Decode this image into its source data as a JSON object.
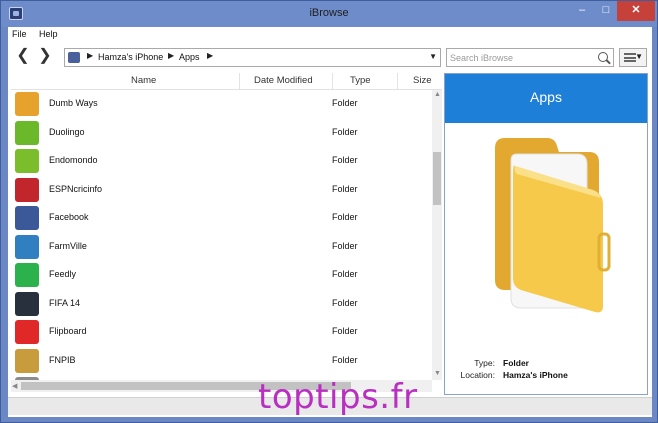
{
  "window": {
    "title": "iBrowse"
  },
  "menu": [
    "File",
    "Help"
  ],
  "address": {
    "crumbs": [
      "Hamza's iPhone",
      "Apps"
    ]
  },
  "search": {
    "placeholder": "Search iBrowse"
  },
  "columns": [
    "Name",
    "Date Modified",
    "Type",
    "Size"
  ],
  "rows": [
    {
      "name": "Dumb Ways",
      "type": "Folder",
      "icon": "dumb-ways-icon",
      "color": "#e6a22c"
    },
    {
      "name": "Duolingo",
      "type": "Folder",
      "icon": "duolingo-icon",
      "color": "#6bb82b"
    },
    {
      "name": "Endomondo",
      "type": "Folder",
      "icon": "endomondo-icon",
      "color": "#7bbd2a"
    },
    {
      "name": "ESPNcricinfo",
      "type": "Folder",
      "icon": "espncricinfo-icon",
      "color": "#c0262b"
    },
    {
      "name": "Facebook",
      "type": "Folder",
      "icon": "facebook-icon",
      "color": "#3b5998"
    },
    {
      "name": "FarmVille",
      "type": "Folder",
      "icon": "farmville-icon",
      "color": "#2f7fc1"
    },
    {
      "name": "Feedly",
      "type": "Folder",
      "icon": "feedly-icon",
      "color": "#2bb24c"
    },
    {
      "name": "FIFA 14",
      "type": "Folder",
      "icon": "fifa-14-icon",
      "color": "#28303d"
    },
    {
      "name": "Flipboard",
      "type": "Folder",
      "icon": "flipboard-icon",
      "color": "#e12828"
    },
    {
      "name": "FNPIB",
      "type": "Folder",
      "icon": "fnpib-icon",
      "color": "#c89b3c"
    },
    {
      "name": "",
      "type": "",
      "icon": "partial-app-icon",
      "color": "#8c8c8c"
    }
  ],
  "preview": {
    "title": "Apps",
    "type_label": "Type:",
    "type_value": "Folder",
    "location_label": "Location:",
    "location_value": "Hamza's iPhone"
  },
  "watermark": "toptips.fr",
  "colors": {
    "titlebar": "#6e8cc9",
    "preview_header": "#1e7fd8",
    "close": "#c7413b",
    "watermark": "#b92fc2"
  }
}
